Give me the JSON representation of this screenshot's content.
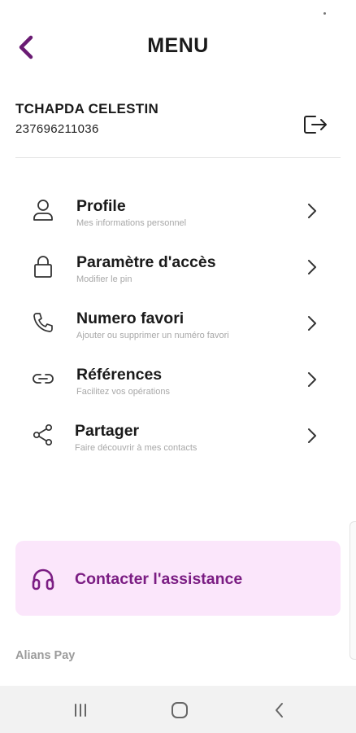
{
  "header": {
    "title": "MENU",
    "back_icon": "chevron-left-icon"
  },
  "user": {
    "name": "TCHAPDA CELESTIN",
    "phone": "237696211036",
    "logout_icon": "logout-icon"
  },
  "menu": {
    "items": [
      {
        "label": "Profile",
        "subtitle": "Mes informations personnel",
        "icon": "user-icon"
      },
      {
        "label": "Paramètre d'accès",
        "subtitle": "Modifier le pin",
        "icon": "lock-icon"
      },
      {
        "label": "Numero favori",
        "subtitle": "Ajouter ou supprimer un numéro favori",
        "icon": "phone-icon"
      },
      {
        "label": "Références",
        "subtitle": "Facilitez vos opérations",
        "icon": "link-icon"
      },
      {
        "label": "Partager",
        "subtitle": "Faire découvrir à mes contacts",
        "icon": "share-icon"
      }
    ]
  },
  "assistance": {
    "label": "Contacter l'assistance",
    "icon": "headphones-icon"
  },
  "footer": {
    "brand": "Alians Pay"
  },
  "navbar": {
    "items": [
      "recent-apps-icon",
      "home-icon",
      "back-icon"
    ]
  },
  "colors": {
    "accent": "#7b1d83",
    "assist_bg": "#fbe6fb",
    "subtitle": "#a8a8a8",
    "navbar_bg": "#f2f2f2"
  }
}
